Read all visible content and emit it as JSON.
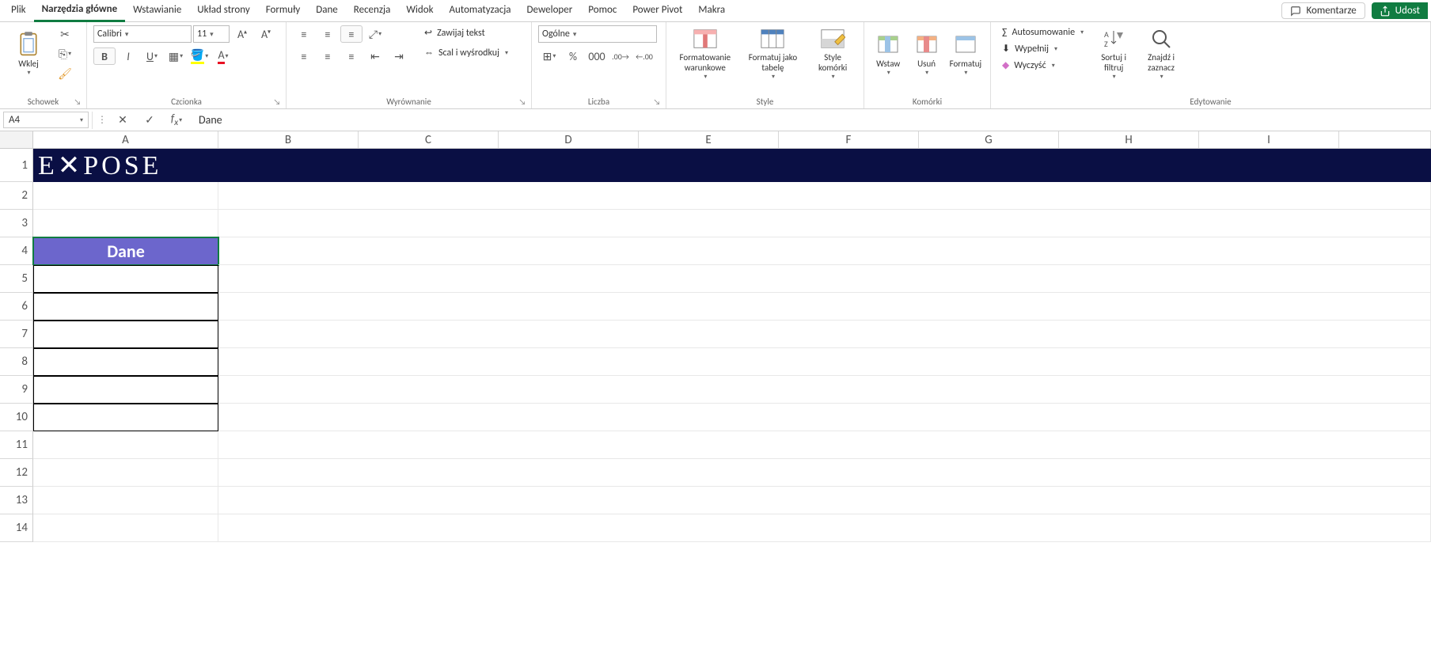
{
  "tabs": {
    "items": [
      "Plik",
      "Narzędzia główne",
      "Wstawianie",
      "Układ strony",
      "Formuły",
      "Dane",
      "Recenzja",
      "Widok",
      "Automatyzacja",
      "Deweloper",
      "Pomoc",
      "Power Pivot",
      "Makra"
    ],
    "active_index": 1
  },
  "titlebar": {
    "comments": "Komentarze",
    "share": "Udost"
  },
  "ribbon": {
    "clipboard": {
      "paste": "Wklej",
      "label": "Schowek"
    },
    "font": {
      "name": "Calibri",
      "size": "11",
      "label": "Czcionka"
    },
    "alignment": {
      "wrap": "Zawijaj tekst",
      "merge": "Scal i wyśrodkuj",
      "label": "Wyrównanie"
    },
    "number": {
      "format": "Ogólne",
      "label": "Liczba"
    },
    "styles": {
      "cond": "Formatowanie warunkowe",
      "table": "Formatuj jako tabelę",
      "cell": "Style komórki",
      "label": "Style"
    },
    "cells": {
      "insert": "Wstaw",
      "delete": "Usuń",
      "format": "Formatuj",
      "label": "Komórki"
    },
    "editing": {
      "sum": "Autosumowanie",
      "fill": "Wypełnij",
      "clear": "Wyczyść",
      "sort": "Sortuj i filtruj",
      "find": "Znajdź i zaznacz",
      "label": "Edytowanie"
    }
  },
  "formula_bar": {
    "name_box": "A4",
    "formula": "Dane"
  },
  "grid": {
    "columns": [
      "A",
      "B",
      "C",
      "D",
      "E",
      "F",
      "G",
      "H",
      "I"
    ],
    "rows": [
      "1",
      "2",
      "3",
      "4",
      "5",
      "6",
      "7",
      "8",
      "9",
      "10",
      "11",
      "12",
      "13",
      "14"
    ],
    "banner_text": "E✕POSE",
    "dane_header": "Dane"
  }
}
